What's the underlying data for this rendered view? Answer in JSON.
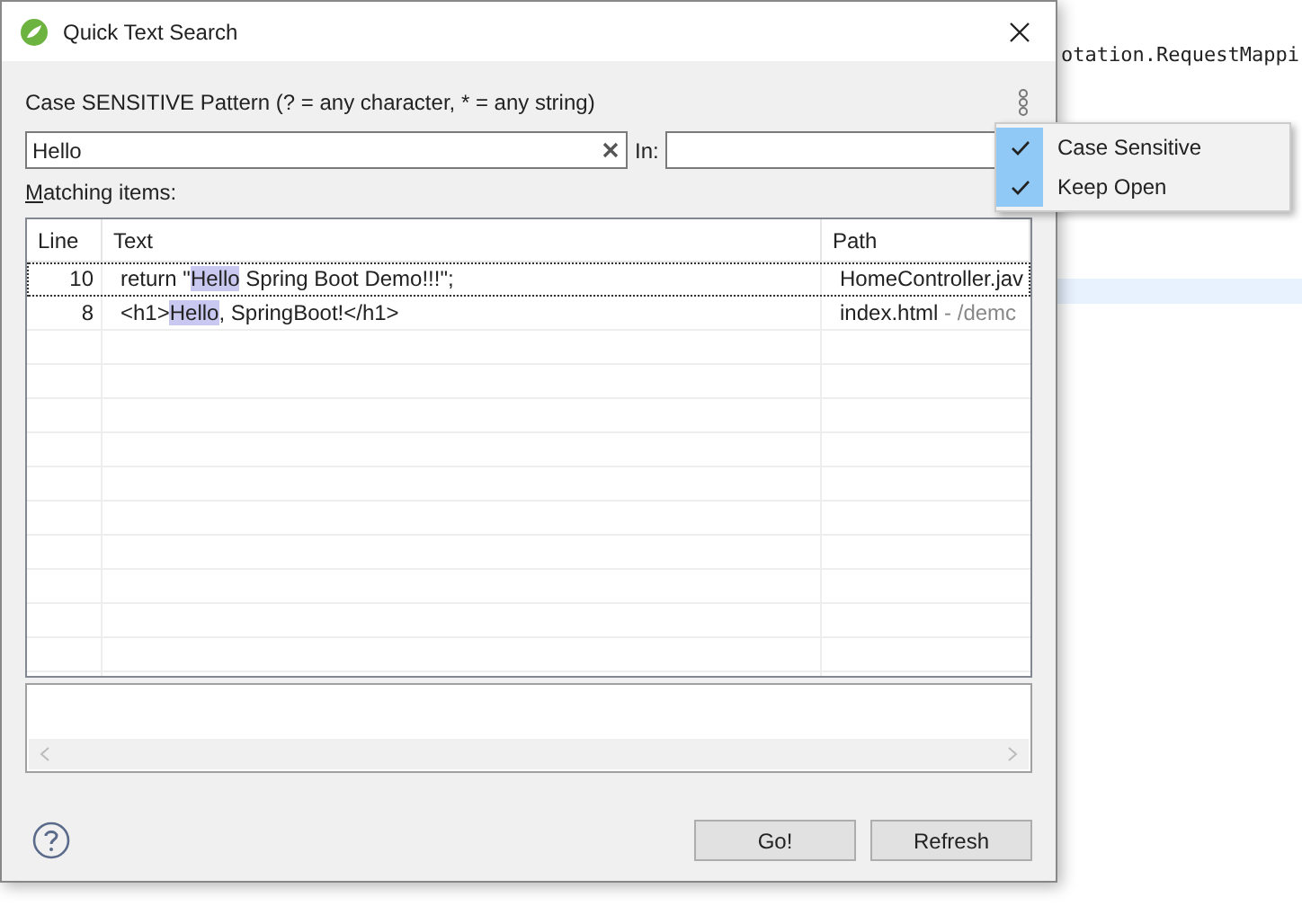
{
  "background_editor": {
    "lines": [
      "otation.RequestMappi"
    ]
  },
  "dialog": {
    "title": "Quick Text Search",
    "pattern_label": "Case SENSITIVE Pattern (? = any character, * = any string)",
    "search": {
      "value": "Hello"
    },
    "in_label": "In:",
    "matching_label": "Matching items:",
    "columns": [
      "Line",
      "Text",
      "Path"
    ],
    "rows": [
      {
        "line": "10",
        "before": "return \"",
        "match": "Hello",
        "after": " Spring Boot Demo!!!\";",
        "file": "HomeController.jav",
        "folder": "",
        "selected": true
      },
      {
        "line": "8",
        "before": "<h1>",
        "match": "Hello",
        "after": ", SpringBoot!</h1>",
        "file": "index.html",
        "folder": " - /demc",
        "selected": false
      }
    ],
    "buttons": [
      "Go!",
      "Refresh"
    ]
  },
  "menu": {
    "items": [
      {
        "label": "Case Sensitive",
        "checked": true
      },
      {
        "label": "Keep Open",
        "checked": true
      }
    ]
  }
}
